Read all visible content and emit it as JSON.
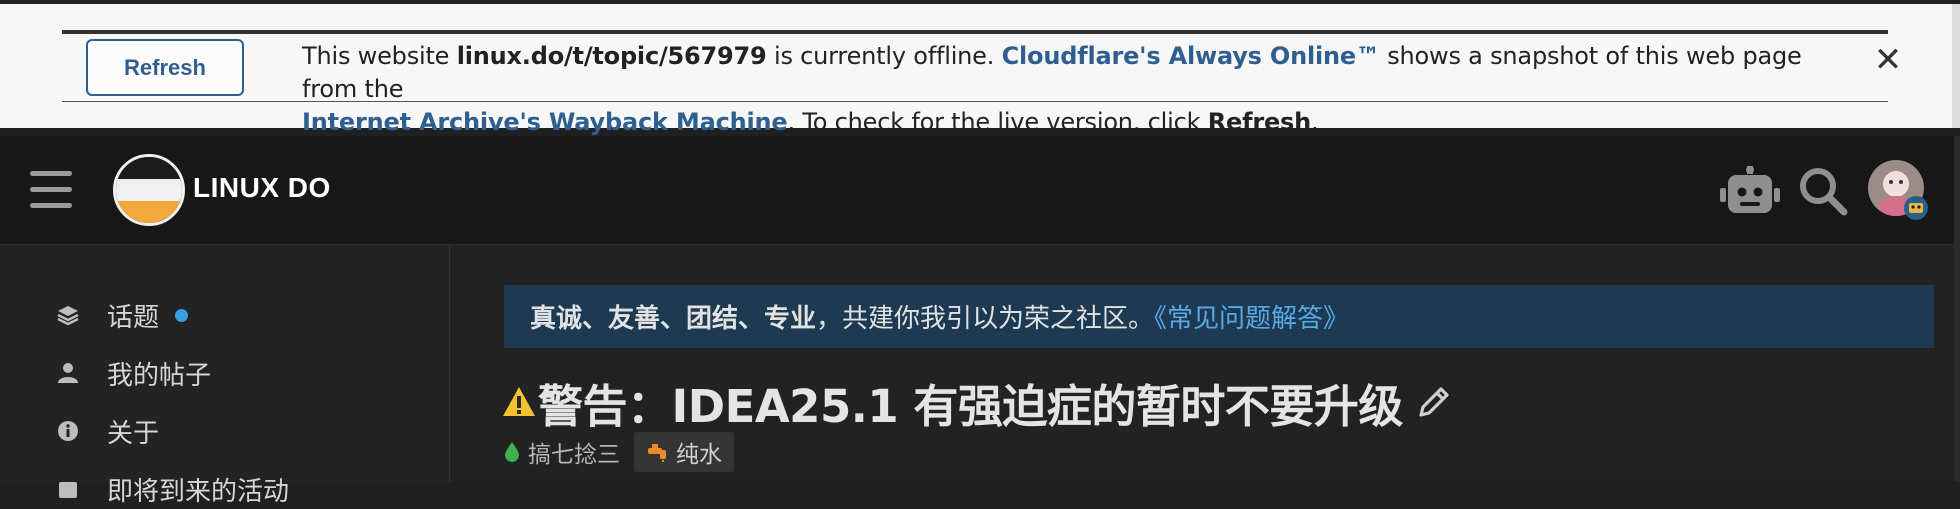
{
  "cloudflare_banner": {
    "refresh_label": "Refresh",
    "msg_part1": "This website ",
    "site_url": "linux.do/t/topic/567979",
    "msg_part2": " is currently offline. ",
    "always_online_link": "Cloudflare's Always Online™",
    "msg_part3": " shows a snapshot of this web page from the ",
    "wayback_link": "Internet Archive's Wayback Machine",
    "msg_part4": ". To check for the live version, click ",
    "refresh_word": "Refresh",
    "msg_part5": ".",
    "close_label": "✕"
  },
  "header": {
    "site_title": "LINUX DO",
    "icons": [
      "menu-icon",
      "robot-icon",
      "search-icon",
      "user-avatar"
    ]
  },
  "sidebar": {
    "items": [
      {
        "label": "话题",
        "icon": "layers-icon",
        "unread_dot": true
      },
      {
        "label": "我的帖子",
        "icon": "person-icon"
      },
      {
        "label": "关于",
        "icon": "info-icon"
      },
      {
        "label": "即将到来的活动",
        "icon": "calendar-icon"
      }
    ]
  },
  "notice": {
    "bold_values": "真诚、友善、团结、专业",
    "text": "，共建你我引以为荣之社区。",
    "faq_link": "《常见问题解答》"
  },
  "topic": {
    "warning_icon": "⚠️",
    "title": "警告：IDEA25.1 有强迫症的暂时不要升级",
    "category": "搞七捻三",
    "tag": "纯水"
  },
  "colors": {
    "banner_link": "#2f5f8f",
    "notice_bg": "#1d3a52",
    "faq_link": "#58a9e8",
    "unread_dot": "#3aa0e6",
    "logo_orange": "#f0a93a"
  }
}
